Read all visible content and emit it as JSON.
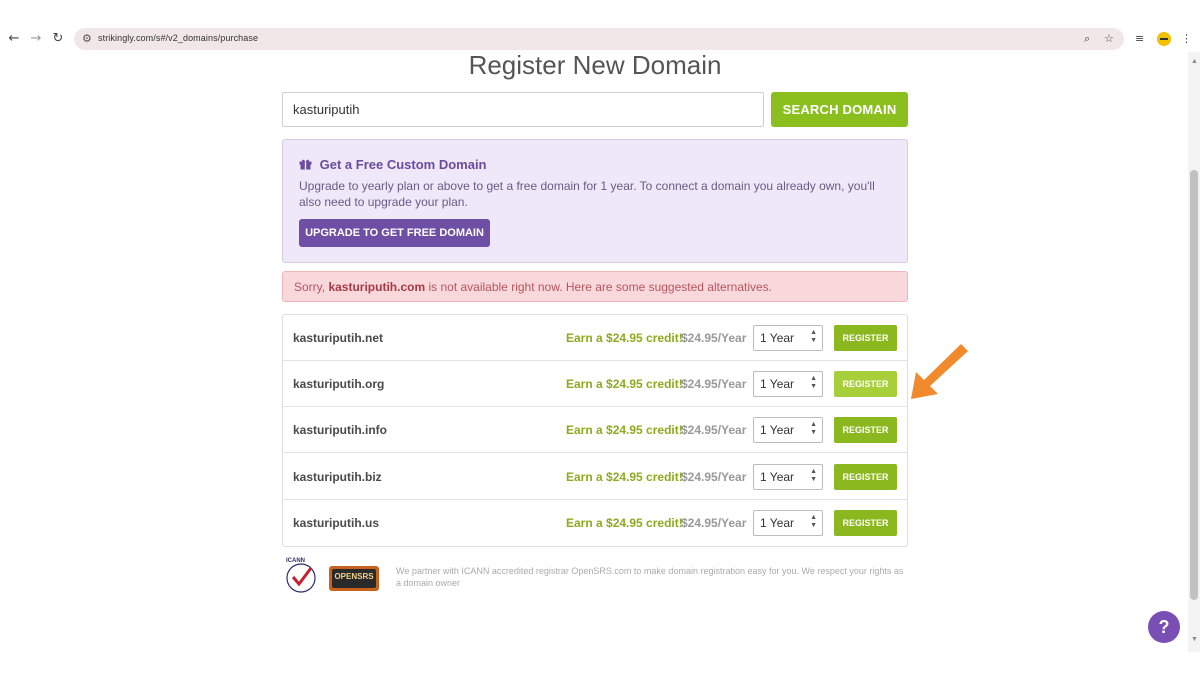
{
  "browser": {
    "back_icon": "←",
    "forward_icon": "→",
    "reload_icon": "↻",
    "url": "strikingly.com/s#/v2_domains/purchase"
  },
  "page": {
    "title": "Register New Domain"
  },
  "search": {
    "value": "kasturiputih",
    "button_label": "SEARCH DOMAIN"
  },
  "promo": {
    "title": "Get a Free Custom Domain",
    "text": "Upgrade to yearly plan or above to get a free domain for 1 year. To connect a domain you already own, you'll also need to upgrade your plan.",
    "button_label": "UPGRADE TO GET FREE DOMAIN",
    "accent_color": "#6f4fa5"
  },
  "alert": {
    "prefix": "Sorry, ",
    "domain": "kasturiputih.com",
    "suffix": " is not available right now. Here are some suggested alternatives."
  },
  "results": [
    {
      "domain": "kasturiputih.net",
      "credit": "Earn a $24.95 credit!",
      "price": "$24.95/Year",
      "term": "1 Year",
      "button": "REGISTER"
    },
    {
      "domain": "kasturiputih.org",
      "credit": "Earn a $24.95 credit!",
      "price": "$24.95/Year",
      "term": "1 Year",
      "button": "REGISTER"
    },
    {
      "domain": "kasturiputih.info",
      "credit": "Earn a $24.95 credit!",
      "price": "$24.95/Year",
      "term": "1 Year",
      "button": "REGISTER"
    },
    {
      "domain": "kasturiputih.biz",
      "credit": "Earn a $24.95 credit!",
      "price": "$24.95/Year",
      "term": "1 Year",
      "button": "REGISTER"
    },
    {
      "domain": "kasturiputih.us",
      "credit": "Earn a $24.95 credit!",
      "price": "$24.95/Year",
      "term": "1 Year",
      "button": "REGISTER"
    }
  ],
  "footer": {
    "text": "We partner with ICANN accredited registrar OpenSRS.com to make domain registration easy for you. We respect your rights as a domain owner",
    "logo_icann": "ICANN",
    "logo_opensrs": "OPENSRS"
  },
  "help": {
    "label": "?"
  },
  "colors": {
    "brand_green": "#8bbf1e",
    "purple": "#6f4fa5",
    "alert_bg": "#f9d8dc",
    "annotation_arrow": "#f08a2c"
  }
}
